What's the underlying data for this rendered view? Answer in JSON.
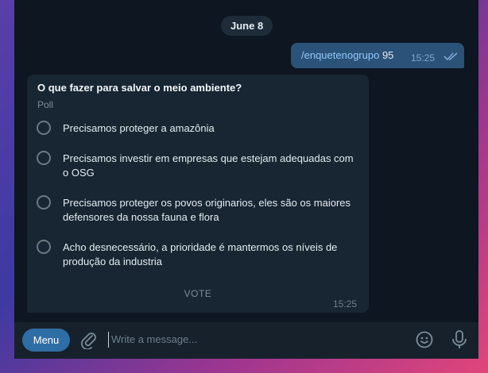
{
  "chat": {
    "date": "June 8",
    "outgoing": {
      "command": "/enquetenogrupo",
      "argument": "95",
      "time": "15:25"
    },
    "poll": {
      "question": "O que fazer para salvar o meio ambiente?",
      "type_label": "Poll",
      "options": [
        "Precisamos proteger a amazônia",
        "Precisamos investir em empresas que estejam adequadas com o OSG",
        "Precisamos proteger os povos originarios, eles são os maiores defensores da nossa fauna e flora",
        "Acho desnecessário, a prioridade é mantermos os níveis de produção da industria"
      ],
      "vote_label": "VOTE",
      "time": "15:25"
    }
  },
  "composer": {
    "menu_label": "Menu",
    "placeholder": "Write a message..."
  },
  "icons": {
    "attach": "paperclip-icon",
    "emoji": "smiley-icon",
    "mic": "microphone-icon",
    "read": "double-check-icon"
  },
  "colors": {
    "background": "#0e1621",
    "outgoing_bubble": "#2b5278",
    "incoming_bubble": "#182533",
    "accent": "#2f6ea5"
  }
}
